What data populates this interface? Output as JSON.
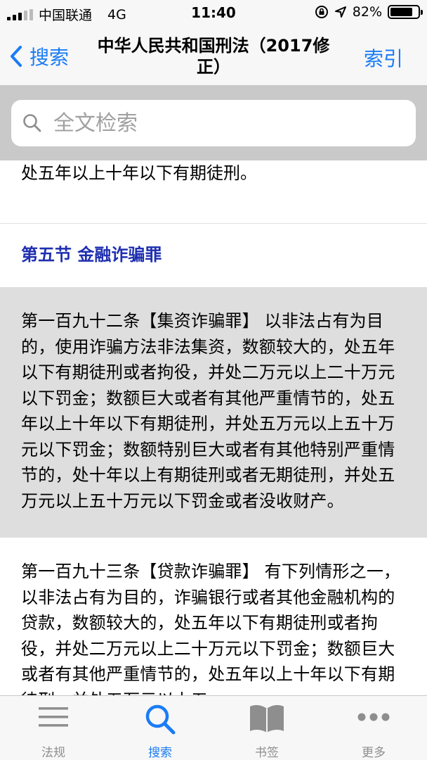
{
  "status": {
    "carrier": "中国联通",
    "network": "4G",
    "time": "11:40",
    "battery": "82%",
    "battery_level": 0.82
  },
  "nav": {
    "back_label": "搜索",
    "title": "中华人民共和国刑法（2017修正）",
    "right_label": "索引"
  },
  "search": {
    "placeholder": "全文检索"
  },
  "content": {
    "prev_tail": "处五年以上十年以下有期徒刑。",
    "section_title": "第五节 金融诈骗罪",
    "article_192": "第一百九十二条【集资诈骗罪】 以非法占有为目的，使用诈骗方法非法集资，数额较大的，处五年以下有期徒刑或者拘役，并处二万元以上二十万元以下罚金；数额巨大或者有其他严重情节的，处五年以上十年以下有期徒刑，并处五万元以上五十万元以下罚金；数额特别巨大或者有其他特别严重情节的，处十年以上有期徒刑或者无期徒刑，并处五万元以上五十万元以下罚金或者没收财产。",
    "article_193": "第一百九十三条【贷款诈骗罪】 有下列情形之一，以非法占有为目的，诈骗银行或者其他金融机构的贷款，数额较大的，处五年以下有期徒刑或者拘役，并处二万元以上二十万元以下罚金；数额巨大或者有其他严重情节的，处五年以上十年以下有期徒刑，并处五万元以上五"
  },
  "tabs": [
    {
      "label": "法规",
      "icon": "list-icon"
    },
    {
      "label": "搜索",
      "icon": "search-icon",
      "active": true
    },
    {
      "label": "书签",
      "icon": "book-icon"
    },
    {
      "label": "更多",
      "icon": "more-icon"
    }
  ],
  "colors": {
    "accent": "#1a7cf6",
    "section_title": "#1e2fb0",
    "highlight_bg": "#dedede"
  }
}
